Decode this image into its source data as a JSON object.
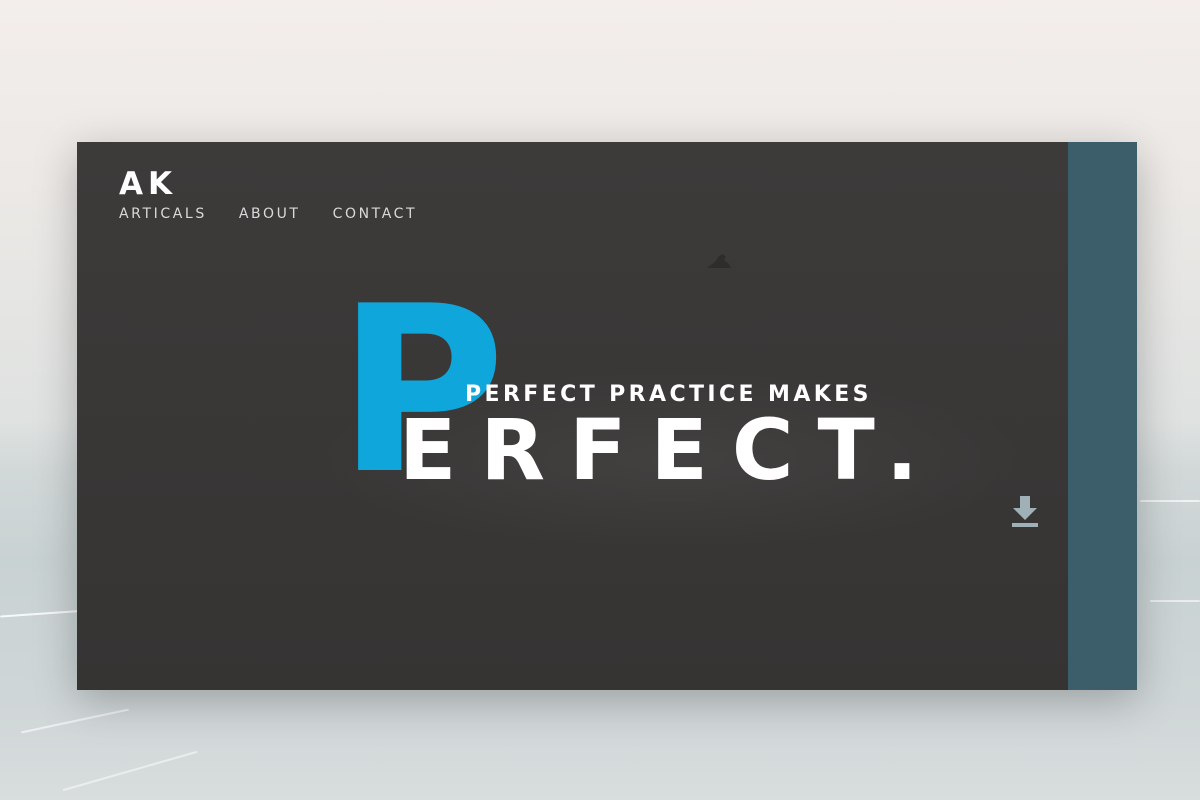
{
  "brand": {
    "logo": "AK"
  },
  "nav": {
    "items": [
      {
        "label": "ARTICALS"
      },
      {
        "label": "ABOUT"
      },
      {
        "label": "CONTACT"
      }
    ]
  },
  "hero": {
    "big_letter": "P",
    "subtitle": "PERFECT PRACTICE MAKES",
    "word_rest": "ERFECT."
  },
  "icons": {
    "download": "download-icon",
    "bird": "bird-silhouette"
  },
  "colors": {
    "accent": "#0fa6dc",
    "card": "#3a3837",
    "side_panel": "#3b5e6a",
    "text": "#ffffff"
  }
}
